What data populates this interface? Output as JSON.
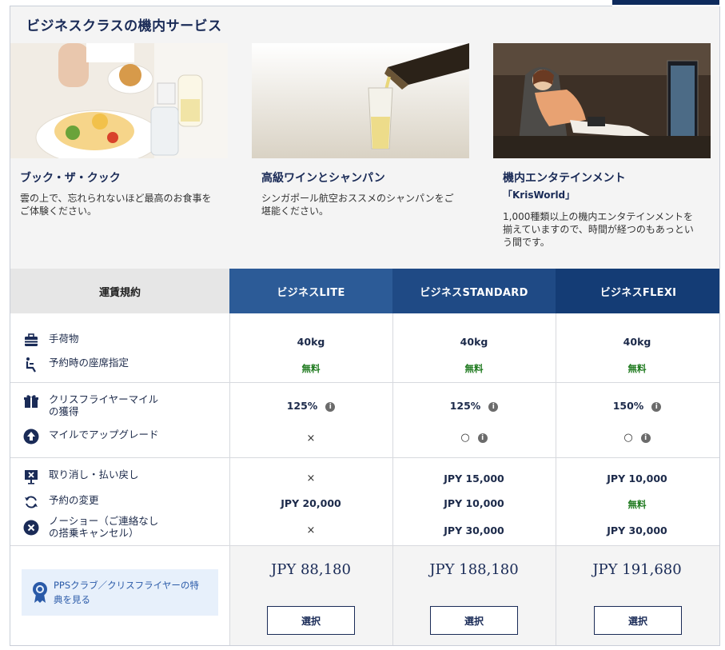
{
  "section_title": "ビジネスクラスの機内サービス",
  "cards": [
    {
      "title": "ブック・ザ・クック",
      "sub": "",
      "desc_l1": "雲の上で、忘れられないほど最高のお食事を",
      "desc_l2": "ご体験ください。",
      "desc_l3": ""
    },
    {
      "title": "高級ワインとシャンパン",
      "sub": "",
      "desc_l1": "シンガポール航空おススメのシャンパンをご",
      "desc_l2": "堪能ください。",
      "desc_l3": ""
    },
    {
      "title": "機内エンタテインメント",
      "sub": "「KrisWorld」",
      "desc_l1": "1,000種類以上の機内エンタテインメントを",
      "desc_l2": "揃えていますので、時間が経つのもあっとい",
      "desc_l3": "う間です。"
    }
  ],
  "table": {
    "rules_header": "運賃規約",
    "fares": [
      "ビジネスLITE",
      "ビジネスSTANDARD",
      "ビジネスFLEXI"
    ],
    "rows": {
      "baggage": "手荷物",
      "seat": "予約時の座席指定",
      "miles_l1": "クリスフライヤーマイル",
      "miles_l2": "の獲得",
      "upgrade": "マイルでアップグレード",
      "cancel": "取り消し・払い戻し",
      "change": "予約の変更",
      "noshow_l1": "ノーショー（ご連絡なし",
      "noshow_l2": "の搭乗キャンセル）"
    },
    "lite": {
      "baggage": "40kg",
      "seat": "無料",
      "miles": "125%",
      "upgrade": "×",
      "cancel": "×",
      "change": "JPY 20,000",
      "noshow": "×",
      "price": "JPY 88,180"
    },
    "standard": {
      "baggage": "40kg",
      "seat": "無料",
      "miles": "125%",
      "upgrade": "○",
      "cancel": "JPY 15,000",
      "change": "JPY 10,000",
      "noshow": "JPY 30,000",
      "price": "JPY 188,180"
    },
    "flexi": {
      "baggage": "40kg",
      "seat": "無料",
      "miles": "150%",
      "upgrade": "○",
      "cancel": "JPY 10,000",
      "change": "無料",
      "noshow": "JPY 30,000",
      "price": "JPY 191,680"
    },
    "info_glyph": "i",
    "select_label": "選択",
    "pps_l1": "PPSクラブ／クリスフライヤーの特",
    "pps_l2": "典を見る"
  },
  "colors": {
    "navy": "#1a2b57",
    "header_lite": "#2c5b97",
    "header_std": "#1f4a85",
    "header_flexi": "#143c75",
    "free_green": "#1f7a1f",
    "pps_bg": "#e7f0fb"
  },
  "icons": [
    "suitcase-icon",
    "seat-icon",
    "gift-icon",
    "upgrade-arrow-icon",
    "cancel-screen-icon",
    "change-cycle-icon",
    "no-show-x-icon",
    "medal-badge-icon",
    "info-icon"
  ]
}
